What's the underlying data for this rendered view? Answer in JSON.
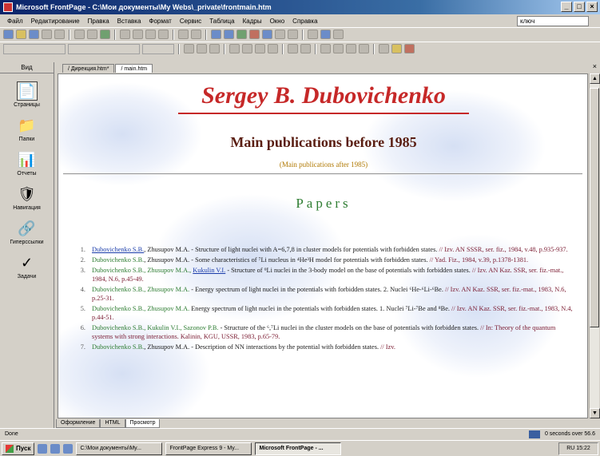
{
  "window": {
    "title": "Microsoft FrontPage - C:\\Мои документы\\My Webs\\_private\\frontmain.htm",
    "buttons": [
      "_",
      "□",
      "×"
    ]
  },
  "menu": [
    "Файл",
    "Редактирование",
    "Правка",
    "Вставка",
    "Формат",
    "Сервис",
    "Таблица",
    "Кадры",
    "Окно",
    "Справка"
  ],
  "help_box": "ключ",
  "views_panel": {
    "header": "Вид",
    "items": [
      {
        "label": "Страницы",
        "icon": "page-view-icon"
      },
      {
        "label": "Папки",
        "icon": "folder-view-icon"
      },
      {
        "label": "Отчеты",
        "icon": "reports-view-icon"
      },
      {
        "label": "Навигация",
        "icon": "navigation-view-icon"
      },
      {
        "label": "Гиперссылки",
        "icon": "hyperlinks-view-icon"
      },
      {
        "label": "Задачи",
        "icon": "tasks-view-icon"
      }
    ]
  },
  "doc_tabs": [
    "/ Дирекция.htm*",
    "/ main.htm"
  ],
  "page": {
    "author": "Sergey B. Dubovichenko",
    "subtitle": "Main publications before 1985",
    "after_link": "(Main publications after 1985)",
    "section_title": "Papers",
    "publications": [
      {
        "num": "1.",
        "author": "Dubovichenko S.B.",
        "rest": ", Zhusupov M.A. - Structure of light nuclei with A=6,7,8 in cluster models for potentials with forbidden states.",
        "source": " // Izv. AN SSSR, ser. fiz., 1984, v.48, p.935-937."
      },
      {
        "num": "2.",
        "author": "Dubovichenko S.B.",
        "rest": ", Zhusupov M.A. - Some characteristics of ⁷Li nucleus in ⁴He³H model for potentials with forbidden states.",
        "source": " // Yad. Fiz., 1984, v.39, p.1378-1381."
      },
      {
        "num": "3.",
        "author": "Dubovichenko S.B., Zhusupov M.A., ",
        "author2": "Kukulin V.I.",
        "rest": " - Structure of ⁹Li nuclei in the 3-body model on the base of potentials with forbidden states.",
        "source": " // Izv. AN Kaz. SSR, ser. fiz.-mat., 1984, N.6, p.45-49."
      },
      {
        "num": "4.",
        "author": "Dubovichenko S.B., Zhusupov M.A.",
        "rest": " - Energy spectrum of light nuclei in the potentials with forbidden states. 2. Nuclei ⁶He-⁶Li-⁶Be.",
        "source": " // Izv. AN Kaz. SSR, ser. fiz.-mat., 1983, N.6, p.25-31."
      },
      {
        "num": "5.",
        "author": "Dubovichenko S.B., Zhusupov M.A.",
        "rest": " Energy spectrum of light nuclei in the potentials with forbidden states. 1. Nuclei ⁷Li-⁷Be and ⁸Be.",
        "source": " // Izv. AN Kaz. SSR, ser. fiz.-mat., 1983, N.4, p.44-51."
      },
      {
        "num": "6.",
        "author": "Dubovichenko S.B., Kukulin V.I., Sazonov P.B.",
        "rest": " - Structure of the ⁶,⁷Li nuclei in the cluster models on the base of potentials with forbidden states.",
        "source": " // In: Theory of the quantum systems with strong interactions. Kalinin, KGU, USSR, 1983, p.65-79."
      },
      {
        "num": "7.",
        "author": "Dubovichenko S.B.",
        "rest": ", Zhusupov M.A. - Description of NN interactions by the potential with forbidden states.",
        "source": " // Izv."
      }
    ]
  },
  "view_tabs": [
    "Оформление",
    "HTML",
    "Просмотр"
  ],
  "status": {
    "left": "Done",
    "right": "0 seconds over 56.6"
  },
  "taskbar": {
    "start": "Пуск",
    "tasks": [
      "C:\\Мои документы\\My...",
      "FrontPage Express 9 - My...",
      "Microsoft FrontPage - ..."
    ],
    "tray": "RU 15:22"
  }
}
